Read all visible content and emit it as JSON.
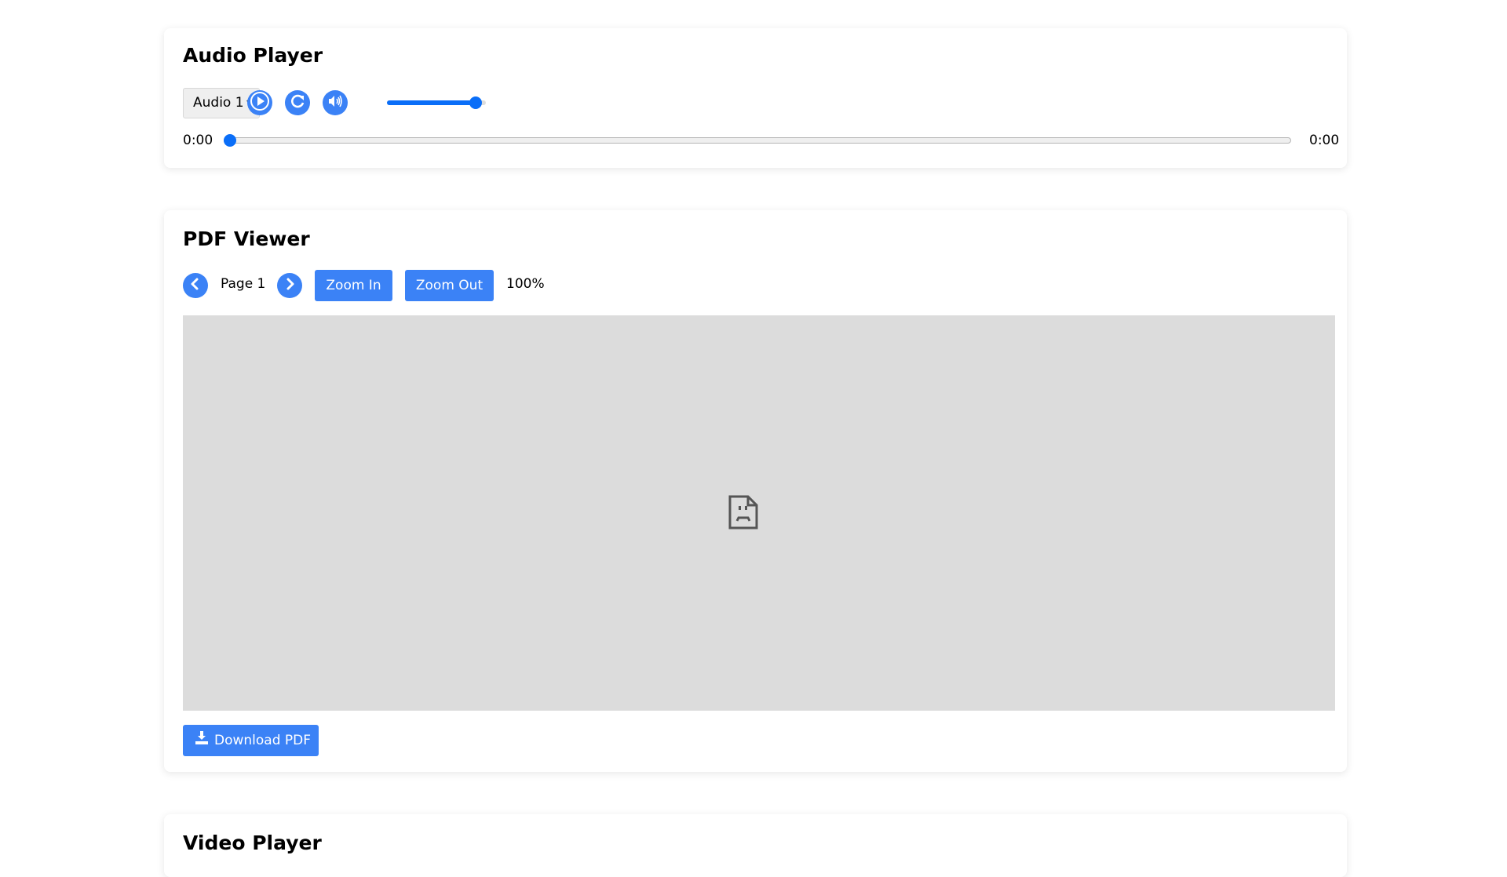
{
  "audio": {
    "title": "Audio Player",
    "select": {
      "selected": "Audio 1"
    },
    "play_icon": "play-icon",
    "replay_icon": "rotate-right-icon",
    "volume_icon": "volume-icon",
    "volume_level": 0.95,
    "progress": 0,
    "current_time": "0:00",
    "duration": "0:00"
  },
  "pdf": {
    "title": "PDF Viewer",
    "prev_icon": "chevron-left-icon",
    "next_icon": "chevron-right-icon",
    "page_label": "Page 1",
    "zoom_in_label": "Zoom In",
    "zoom_out_label": "Zoom Out",
    "zoom_level": "100%",
    "placeholder_icon": "broken-document-icon",
    "download_label": "Download PDF",
    "download_icon": "download-icon"
  },
  "video": {
    "title": "Video Player"
  },
  "colors": {
    "accent": "#3b82f6",
    "slider": "#0a6ef8",
    "pdf_background": "#dcdcdc"
  }
}
